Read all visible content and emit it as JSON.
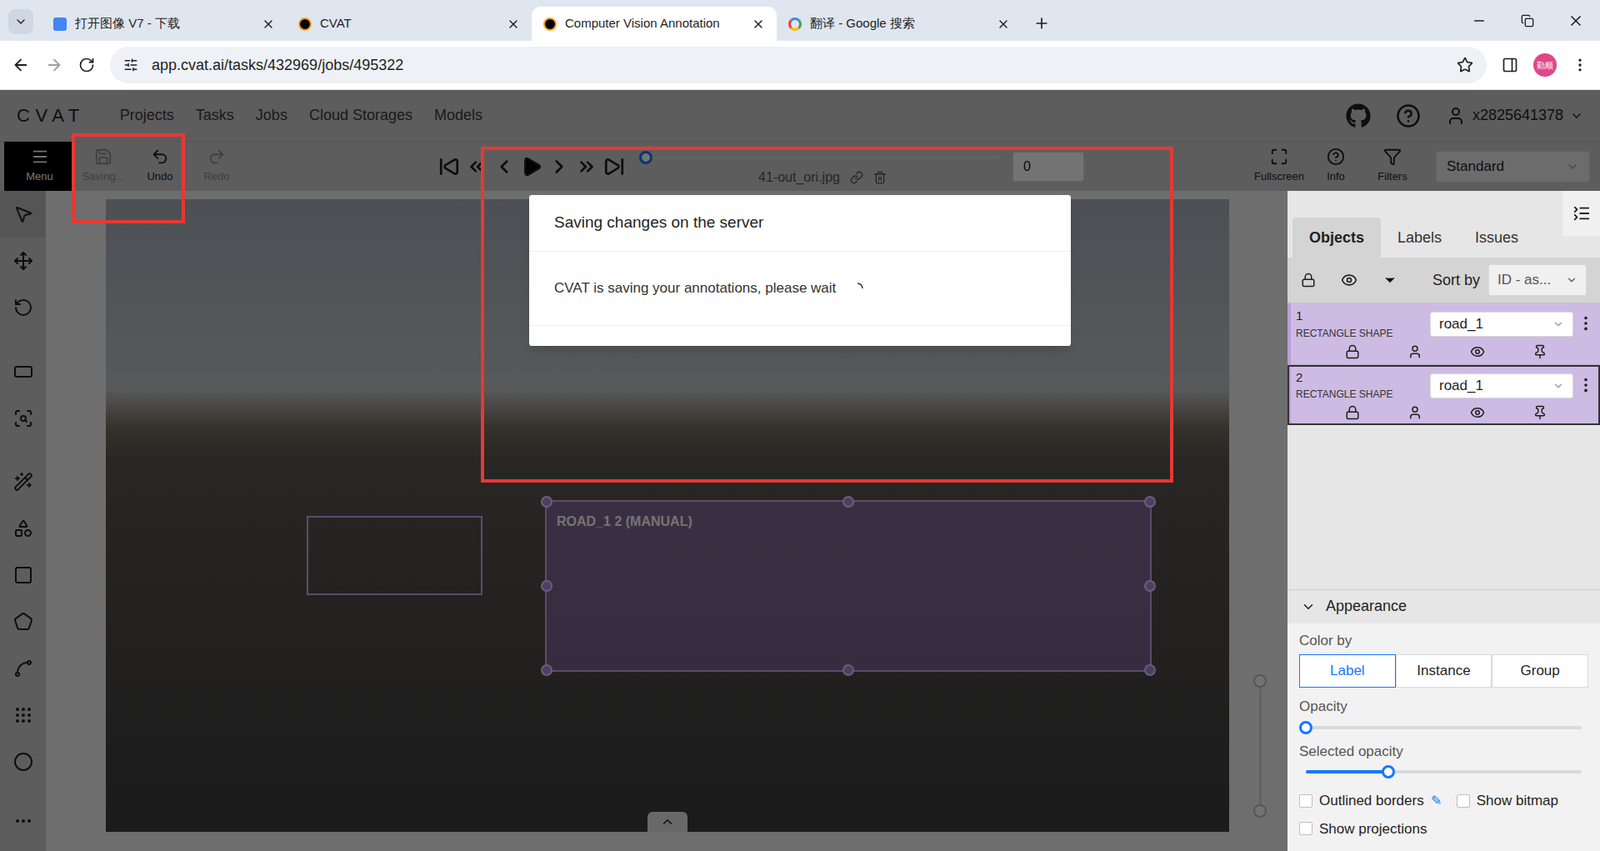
{
  "browser": {
    "tabs": [
      {
        "label": "打开图像 V7 - 下载",
        "selected": false
      },
      {
        "label": "CVAT",
        "selected": false
      },
      {
        "label": "Computer Vision Annotation",
        "selected": true
      },
      {
        "label": "翻译 - Google 搜索",
        "selected": false
      }
    ],
    "url": "app.cvat.ai/tasks/432969/jobs/495322",
    "profile_badge": "勤顺"
  },
  "nav": {
    "logo": "CVAT",
    "items": [
      "Projects",
      "Tasks",
      "Jobs",
      "Cloud Storages",
      "Models"
    ],
    "user": "x2825641378"
  },
  "toolbar": {
    "menu": "Menu",
    "save": {
      "label": "Saving...",
      "disabled": true
    },
    "undo": {
      "label": "Undo",
      "disabled": false
    },
    "redo": {
      "label": "Redo",
      "disabled": true
    },
    "frame_name": "41-out_ori.jpg",
    "frame_number": "0",
    "frame_level": 0,
    "right_buttons": [
      "Fullscreen",
      "Info",
      "Filters"
    ],
    "workspace": "Standard"
  },
  "canvas": {
    "label": "ROAD_1 2 (MANUAL)"
  },
  "sidebar": {
    "tabs": [
      {
        "label": "Objects",
        "selected": true
      },
      {
        "label": "Labels",
        "selected": false
      },
      {
        "label": "Issues",
        "selected": false
      }
    ],
    "sort_label": "Sort by",
    "sort_value": "ID - as...",
    "objects": [
      {
        "id": "1",
        "type": "RECTANGLE SHAPE",
        "label": "road_1",
        "selected": false
      },
      {
        "id": "2",
        "type": "RECTANGLE SHAPE",
        "label": "road_1",
        "selected": true
      }
    ]
  },
  "appearance": {
    "title": "Appearance",
    "color_by_label": "Color by",
    "color_by": [
      {
        "label": "Label",
        "selected": true
      },
      {
        "label": "Instance",
        "selected": false
      },
      {
        "label": "Group",
        "selected": false
      }
    ],
    "opacity_label": "Opacity",
    "opacity_level": 0,
    "selected_opacity_label": "Selected opacity",
    "selected_opacity_level": 0.3,
    "checkboxes": [
      {
        "label": "Outlined borders",
        "checked": false
      },
      {
        "label": "Show bitmap",
        "checked": false
      },
      {
        "label": "Show projections",
        "checked": false
      }
    ]
  },
  "modal": {
    "title": "Saving changes on the server",
    "message": "CVAT is saving your annotations, please wait"
  }
}
